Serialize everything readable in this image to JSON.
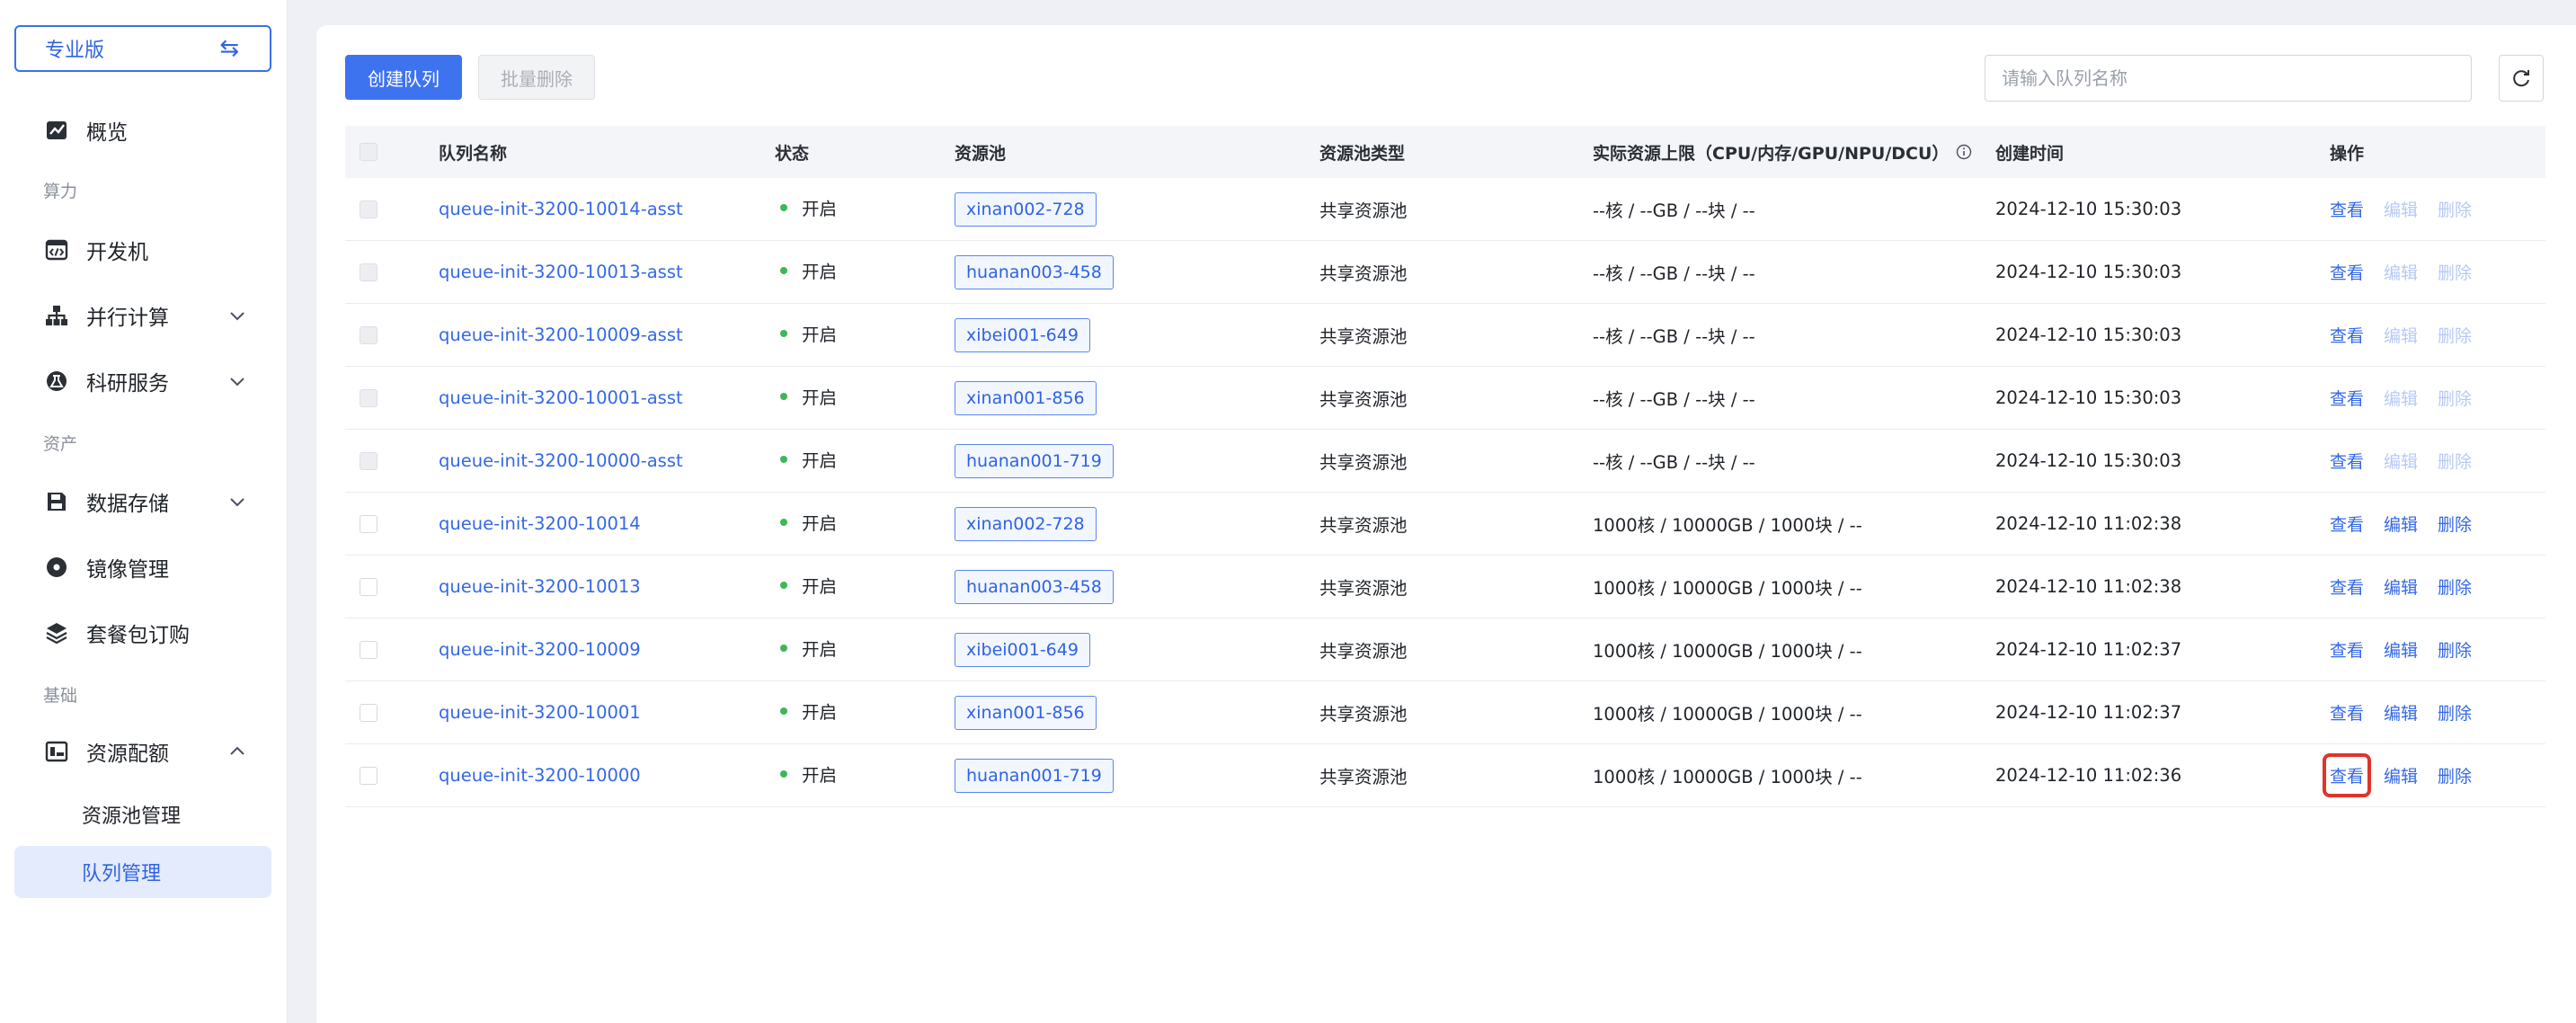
{
  "sidebar": {
    "edition_label": "专业版",
    "edition_switch_icon": "swap-arrows-icon",
    "overview": "概览",
    "group_compute": "算力",
    "devbox": "开发机",
    "parallel": "并行计算",
    "research": "科研服务",
    "group_assets": "资产",
    "storage": "数据存储",
    "images": "镜像管理",
    "packages": "套餐包订购",
    "group_basic": "基础",
    "quota": "资源配额",
    "pool_mgmt": "资源池管理",
    "queue_mgmt": "队列管理"
  },
  "toolbar": {
    "create_label": "创建队列",
    "batch_delete_label": "批量删除",
    "search_placeholder": "请输入队列名称"
  },
  "table": {
    "headers": {
      "name": "队列名称",
      "status": "状态",
      "pool": "资源池",
      "pool_type": "资源池类型",
      "limit": "实际资源上限（CPU/内存/GPU/NPU/DCU）",
      "created": "创建时间",
      "ops": "操作"
    },
    "ops": {
      "view": "查看",
      "edit": "编辑",
      "delete": "删除"
    },
    "rows": [
      {
        "name": "queue-init-3200-10014-asst",
        "status": "开启",
        "pool": "xinan002-728",
        "pool_type": "共享资源池",
        "limit": "--核 / --GB / --块 / --",
        "created": "2024-12-10 15:30:03"
      },
      {
        "name": "queue-init-3200-10013-asst",
        "status": "开启",
        "pool": "huanan003-458",
        "pool_type": "共享资源池",
        "limit": "--核 / --GB / --块 / --",
        "created": "2024-12-10 15:30:03"
      },
      {
        "name": "queue-init-3200-10009-asst",
        "status": "开启",
        "pool": "xibei001-649",
        "pool_type": "共享资源池",
        "limit": "--核 / --GB / --块 / --",
        "created": "2024-12-10 15:30:03"
      },
      {
        "name": "queue-init-3200-10001-asst",
        "status": "开启",
        "pool": "xinan001-856",
        "pool_type": "共享资源池",
        "limit": "--核 / --GB / --块 / --",
        "created": "2024-12-10 15:30:03"
      },
      {
        "name": "queue-init-3200-10000-asst",
        "status": "开启",
        "pool": "huanan001-719",
        "pool_type": "共享资源池",
        "limit": "--核 / --GB / --块 / --",
        "created": "2024-12-10 15:30:03"
      },
      {
        "name": "queue-init-3200-10014",
        "status": "开启",
        "pool": "xinan002-728",
        "pool_type": "共享资源池",
        "limit": "1000核 / 10000GB / 1000块 / --",
        "created": "2024-12-10 11:02:38"
      },
      {
        "name": "queue-init-3200-10013",
        "status": "开启",
        "pool": "huanan003-458",
        "pool_type": "共享资源池",
        "limit": "1000核 / 10000GB / 1000块 / --",
        "created": "2024-12-10 11:02:38"
      },
      {
        "name": "queue-init-3200-10009",
        "status": "开启",
        "pool": "xibei001-649",
        "pool_type": "共享资源池",
        "limit": "1000核 / 10000GB / 1000块 / --",
        "created": "2024-12-10 11:02:37"
      },
      {
        "name": "queue-init-3200-10001",
        "status": "开启",
        "pool": "xinan001-856",
        "pool_type": "共享资源池",
        "limit": "1000核 / 10000GB / 1000块 / --",
        "created": "2024-12-10 11:02:37"
      },
      {
        "name": "queue-init-3200-10000",
        "status": "开启",
        "pool": "huanan001-719",
        "pool_type": "共享资源池",
        "limit": "1000核 / 10000GB / 1000块 / --",
        "created": "2024-12-10 11:02:36"
      }
    ]
  },
  "colors": {
    "accent": "#3e73f0",
    "link": "#3468e6",
    "status_on": "#3fb658",
    "highlight": "#e0342a"
  }
}
